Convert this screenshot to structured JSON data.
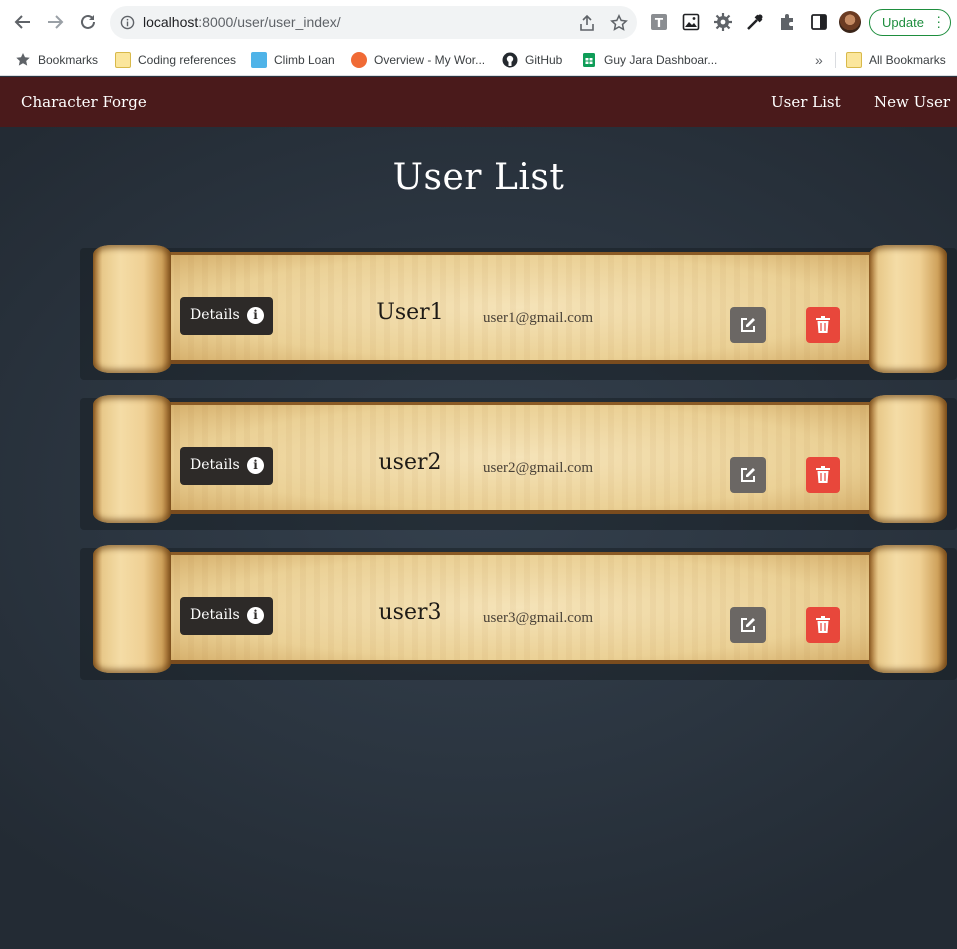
{
  "browser": {
    "url_host": "localhost",
    "url_path": ":8000/user/user_index/",
    "update_label": "Update",
    "bookmarks": [
      {
        "label": "Bookmarks",
        "icon": "star-icon"
      },
      {
        "label": "Coding references",
        "icon": "folder-icon"
      },
      {
        "label": "Climb Loan",
        "icon": "square-app-icon"
      },
      {
        "label": "Overview - My Wor...",
        "icon": "app-logo-icon"
      },
      {
        "label": "GitHub",
        "icon": "github-icon"
      },
      {
        "label": "Guy Jara Dashboar...",
        "icon": "sheets-icon"
      }
    ],
    "overflow_label": "»",
    "all_bookmarks_label": "All Bookmarks"
  },
  "app": {
    "brand": "Character Forge",
    "nav": {
      "user_list": "User List",
      "new_user": "New User"
    },
    "page_title": "User List",
    "details_label": "Details",
    "users": [
      {
        "username": "User1",
        "email": "user1@gmail.com"
      },
      {
        "username": "user2",
        "email": "user2@gmail.com"
      },
      {
        "username": "user3",
        "email": "user3@gmail.com"
      }
    ]
  },
  "colors": {
    "nav_bg": "#4a1a1b",
    "page_bg": "#2a3440",
    "details_bg": "#2d2a28",
    "edit_bg": "#6b6764",
    "delete_bg": "#e8473b"
  }
}
